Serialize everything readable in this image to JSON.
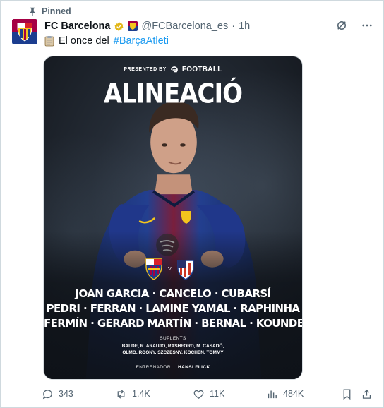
{
  "pinned_label": "Pinned",
  "author": {
    "name": "FC Barcelona",
    "handle": "@FCBarcelona_es",
    "separator": "·",
    "time": "1h"
  },
  "tweet": {
    "text_prefix": "El once del",
    "hashtag": "#BarçaAtleti"
  },
  "poster": {
    "presented_by": "PRESENTED BY",
    "sponsor": "FOOTBALL",
    "title": "ALINEACIÓ",
    "vs": "V",
    "lineup_rows": [
      "JOAN GARCIA · CANCELO · CUBARSÍ",
      "PEDRI · FERRAN · LAMINE YAMAL · RAPHINHA",
      "FERMÍN · GERARD MARTÍN · BERNAL · KOUNDE"
    ],
    "subs_label": "SUPLENTS",
    "subs_rows": [
      "BALDE, R. ARAUJO, RASHFORD, M. CASADÓ,",
      "OLMO, ROONY, SZCZĘSNY, KOCHEN, TOMMY"
    ],
    "coach_label": "ENTRENADOR",
    "coach_name": "HANSI FLICK"
  },
  "actions": {
    "replies": "343",
    "reposts": "1.4K",
    "likes": "11K",
    "views": "484K"
  },
  "icons": [
    "pin-icon",
    "verified-icon",
    "clipboard-icon",
    "grok-icon",
    "more-icon",
    "reply-icon",
    "repost-icon",
    "like-icon",
    "views-icon",
    "bookmark-icon",
    "share-icon"
  ],
  "colors": {
    "barca_blue": "#1b3d8f",
    "barca_red": "#a50044",
    "verified_gold": "#e2b719",
    "link_blue": "#1d9bf0",
    "muted_text": "#536471"
  }
}
